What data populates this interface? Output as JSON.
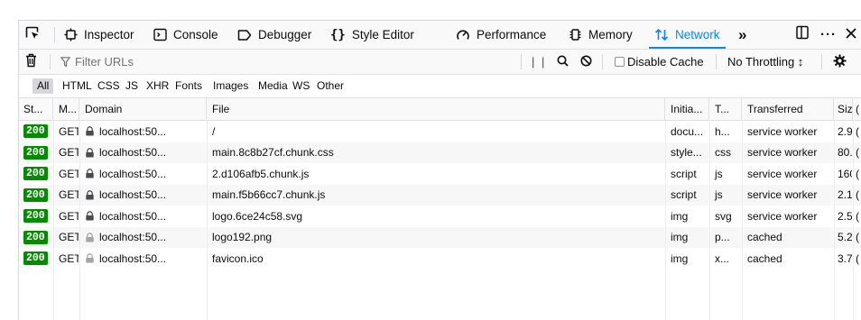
{
  "tabs": {
    "inspector": "Inspector",
    "console": "Console",
    "debugger": "Debugger",
    "style_editor": "Style Editor",
    "performance": "Performance",
    "memory": "Memory",
    "network": "Network"
  },
  "toolbar": {
    "filter_placeholder": "Filter URLs",
    "disable_cache": "Disable Cache",
    "throttling": "No Throttling ↕"
  },
  "type_filters": [
    "All",
    "HTML",
    "CSS",
    "JS",
    "XHR",
    "Fonts",
    "Images",
    "Media",
    "WS",
    "Other"
  ],
  "columns": {
    "status": "St...",
    "method": "M...",
    "domain": "Domain",
    "file": "File",
    "initiator": "Initia...",
    "type": "T...",
    "transferred": "Transferred",
    "size": "Siz",
    "time": "("
  },
  "requests": [
    {
      "status": "200",
      "method": "GET",
      "domain": "localhost:50...",
      "file": "/",
      "initiator": "docu...",
      "type": "h...",
      "transferred": "service worker",
      "size": "2.9",
      "time": "("
    },
    {
      "status": "200",
      "method": "GET",
      "domain": "localhost:50...",
      "file": "main.8c8b27cf.chunk.css",
      "initiator": "style...",
      "type": "css",
      "transferred": "service worker",
      "size": "80.",
      "time": "("
    },
    {
      "status": "200",
      "method": "GET",
      "domain": "localhost:50...",
      "file": "2.d106afb5.chunk.js",
      "initiator": "script",
      "type": "js",
      "transferred": "service worker",
      "size": "160",
      "time": "("
    },
    {
      "status": "200",
      "method": "GET",
      "domain": "localhost:50...",
      "file": "main.f5b66cc7.chunk.js",
      "initiator": "script",
      "type": "js",
      "transferred": "service worker",
      "size": "2.1:",
      "time": "("
    },
    {
      "status": "200",
      "method": "GET",
      "domain": "localhost:50...",
      "file": "logo.6ce24c58.svg",
      "initiator": "img",
      "type": "svg",
      "transferred": "service worker",
      "size": "2.5",
      "time": "("
    },
    {
      "status": "200",
      "method": "GET",
      "domain": "localhost:50...",
      "file": "logo192.png",
      "initiator": "img",
      "type": "p...",
      "transferred": "cached",
      "size": "5.2",
      "time": "("
    },
    {
      "status": "200",
      "method": "GET",
      "domain": "localhost:50...",
      "file": "favicon.ico",
      "initiator": "img",
      "type": "x...",
      "transferred": "cached",
      "size": "3.7",
      "time": "("
    }
  ],
  "colors": {
    "accent": "#0a84ff",
    "status_ok": "#058b00",
    "lock_secure": "#4a4a4f",
    "lock_cached": "#a3a3a8"
  }
}
